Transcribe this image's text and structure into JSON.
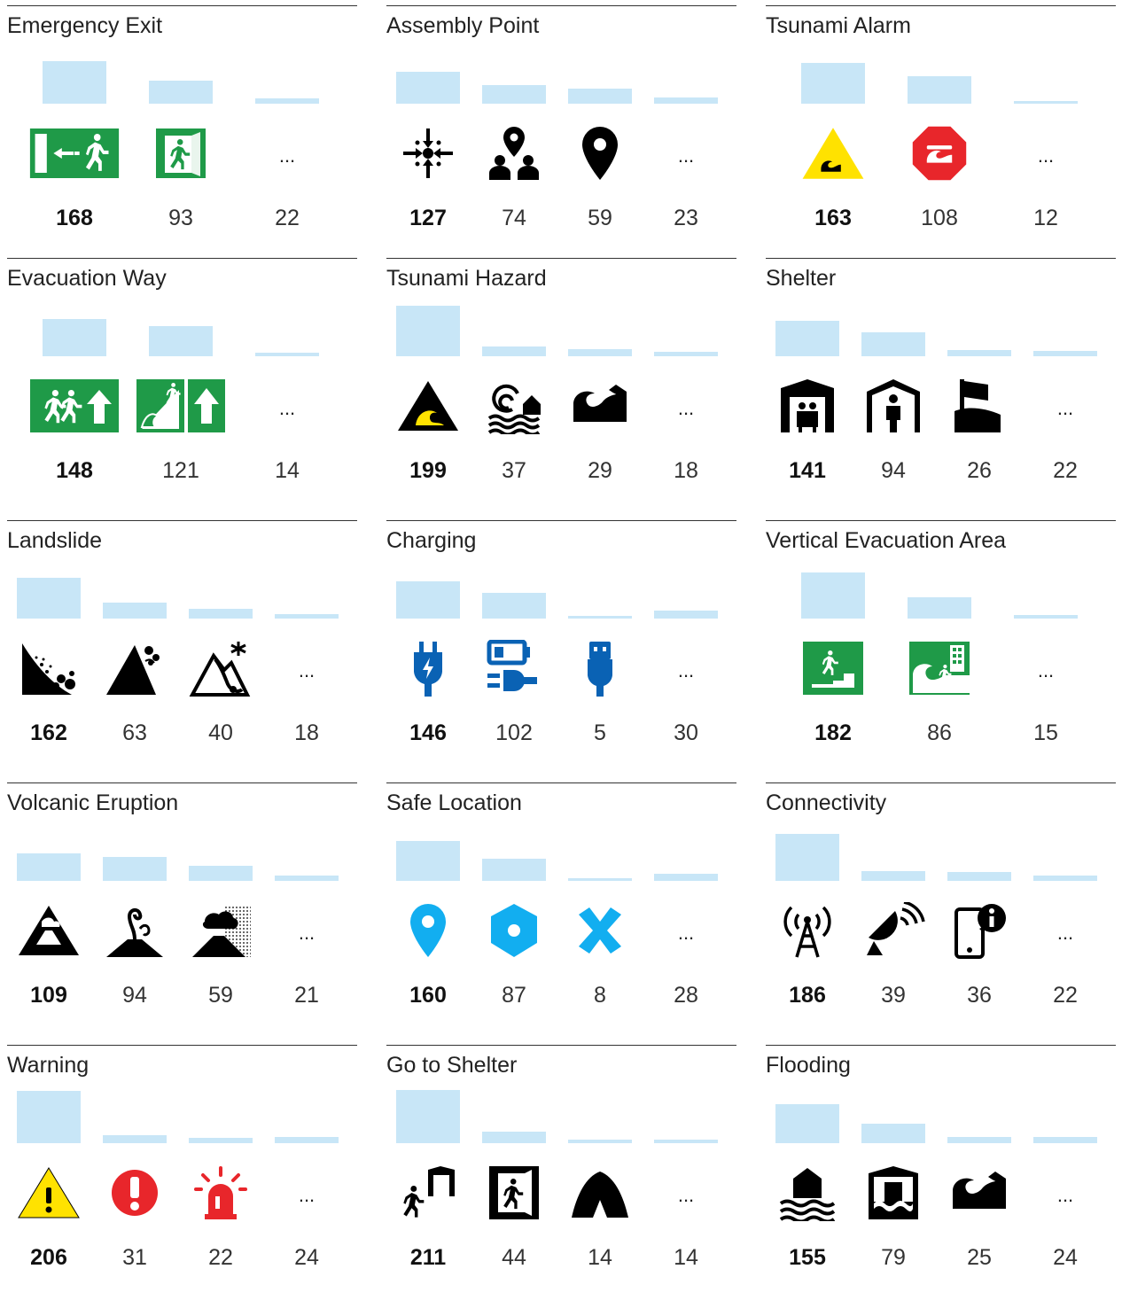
{
  "colors": {
    "bar": "#c8e6f7",
    "green": "#1f9a48",
    "yellow": "#ffe200",
    "red": "#e8262b",
    "blue": "#0a62b4",
    "lightblue": "#12aef0",
    "black": "#000000"
  },
  "ellipsis": "...",
  "chart_data": [
    {
      "type": "bar",
      "title": "Emergency Exit",
      "values": [
        168,
        93,
        22
      ],
      "icons": [
        "emergency-exit-arrow-icon",
        "exit-door-runner-icon",
        "ellipsis"
      ]
    },
    {
      "type": "bar",
      "title": "Assembly Point",
      "values": [
        127,
        74,
        59,
        23
      ],
      "icons": [
        "assembly-arrows-icon",
        "people-pin-icon",
        "map-pin-icon",
        "ellipsis"
      ]
    },
    {
      "type": "bar",
      "title": "Tsunami Alarm",
      "values": [
        163,
        108,
        12
      ],
      "icons": [
        "tsunami-warning-triangle-icon",
        "tsunami-stop-octagon-icon",
        "ellipsis"
      ]
    },
    {
      "type": "bar",
      "title": "Evacuation Way",
      "values": [
        148,
        121,
        14
      ],
      "icons": [
        "evacuation-runners-arrow-icon",
        "evacuation-slope-arrow-icon",
        "ellipsis"
      ]
    },
    {
      "type": "bar",
      "title": "Tsunami Hazard",
      "values": [
        199,
        37,
        29,
        18
      ],
      "icons": [
        "tsunami-hazard-triangle-icon",
        "tsunami-wave-house-icon",
        "tsunami-wave-icon",
        "ellipsis"
      ]
    },
    {
      "type": "bar",
      "title": "Shelter",
      "values": [
        141,
        94,
        26,
        22
      ],
      "icons": [
        "shelter-family-icon",
        "shelter-person-icon",
        "shelter-flag-hill-icon",
        "ellipsis"
      ]
    },
    {
      "type": "bar",
      "title": "Landslide",
      "values": [
        162,
        63,
        40,
        18
      ],
      "icons": [
        "landslide-rocks-icon",
        "mountain-rockfall-icon",
        "avalanche-icon",
        "ellipsis"
      ]
    },
    {
      "type": "bar",
      "title": "Charging",
      "values": [
        146,
        102,
        5,
        30
      ],
      "icons": [
        "plug-bolt-icon",
        "battery-plug-icon",
        "usb-plug-icon",
        "ellipsis"
      ]
    },
    {
      "type": "bar",
      "title": "Vertical Evacuation Area",
      "values": [
        182,
        86,
        15
      ],
      "icons": [
        "vertical-evacuation-stairs-icon",
        "vertical-evacuation-building-icon",
        "ellipsis"
      ]
    },
    {
      "type": "bar",
      "title": "Volcanic Eruption",
      "values": [
        109,
        94,
        59,
        21
      ],
      "icons": [
        "volcano-triangle-icon",
        "volcano-smoke-icon",
        "volcano-ash-icon",
        "ellipsis"
      ]
    },
    {
      "type": "bar",
      "title": "Safe Location",
      "values": [
        160,
        87,
        8,
        28
      ],
      "icons": [
        "blue-pin-icon",
        "blue-hexagon-icon",
        "blue-x-icon",
        "ellipsis"
      ]
    },
    {
      "type": "bar",
      "title": "Connectivity",
      "values": [
        186,
        39,
        36,
        22
      ],
      "icons": [
        "antenna-tower-icon",
        "satellite-dish-icon",
        "phone-info-icon",
        "ellipsis"
      ]
    },
    {
      "type": "bar",
      "title": "Warning",
      "values": [
        206,
        31,
        22,
        24
      ],
      "icons": [
        "warning-triangle-icon",
        "red-exclamation-icon",
        "red-siren-icon",
        "ellipsis"
      ]
    },
    {
      "type": "bar",
      "title": "Go to Shelter",
      "values": [
        211,
        44,
        14,
        14
      ],
      "icons": [
        "runner-to-shelter-icon",
        "exit-door-runner-black-icon",
        "tent-icon",
        "ellipsis"
      ]
    },
    {
      "type": "bar",
      "title": "Flooding",
      "values": [
        155,
        79,
        25,
        24
      ],
      "icons": [
        "flood-house-icon",
        "flood-building-icon",
        "tsunami-wave-icon",
        "ellipsis"
      ]
    }
  ]
}
